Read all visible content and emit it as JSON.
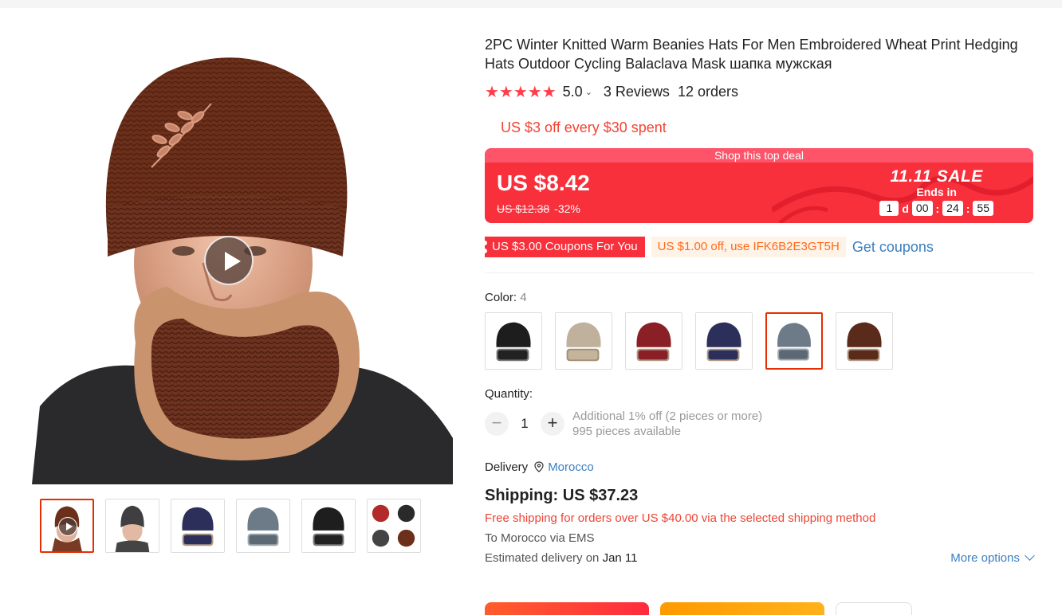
{
  "product": {
    "title": "2PC Winter Knitted Warm Beanies Hats For Men Embroidered Wheat Print Hedging Hats Outdoor Cycling Balaclava Mask шапка мужская",
    "rating": "5.0",
    "stars": "★★★★★",
    "reviews": "3 Reviews",
    "orders": "12 orders"
  },
  "promo": {
    "text": "US $3 off every $30 spent"
  },
  "deal": {
    "header": "Shop this top deal",
    "price": "US $8.42",
    "original_price": "US $12.38",
    "discount": "-32%",
    "sale_title": "11.11 SALE",
    "ends_in": "Ends in",
    "countdown": {
      "days": "1",
      "days_unit": "d",
      "hours": "00",
      "minutes": "24",
      "seconds": "55",
      "sep": ":"
    }
  },
  "coupons": {
    "store_coupon": "US $3.00 Coupons For You",
    "code_coupon": "US $1.00 off, use IFK6B2E3GT5H",
    "get_link": "Get coupons"
  },
  "color": {
    "label": "Color: ",
    "selected_index": "4",
    "swatches": [
      "black",
      "beige",
      "burgundy",
      "navy",
      "grey",
      "brown"
    ]
  },
  "quantity": {
    "label": "Quantity:",
    "value": "1",
    "minus": "−",
    "plus": "+",
    "discount_note": "Additional 1% off (2 pieces or more)",
    "available": "995 pieces available"
  },
  "delivery": {
    "label": "Delivery",
    "location": "Morocco",
    "shipping": "Shipping: US $37.23",
    "free_shipping": "Free shipping for orders over US $40.00 via the selected shipping method",
    "to_prefix": "To Morocco via EMS",
    "estimated_prefix": "Estimated delivery on ",
    "estimated_date": "Jan 11",
    "more_options": "More options"
  },
  "colors": {
    "accent_red": "#f7303c",
    "promo_red": "#ee4535",
    "link_blue": "#3a7fc0",
    "coupon_orange": "#ff6a1a"
  }
}
